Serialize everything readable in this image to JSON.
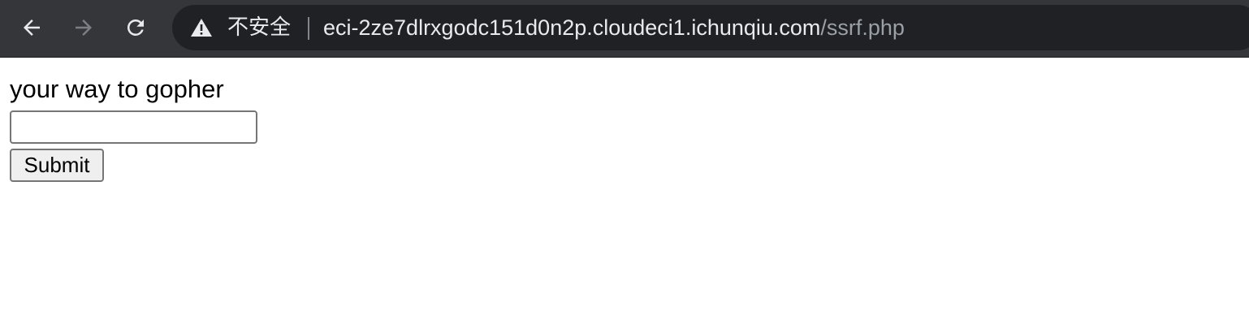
{
  "browser": {
    "nav": {
      "back_icon": "arrow-left-icon",
      "forward_icon": "arrow-right-icon",
      "reload_icon": "reload-icon"
    },
    "omnibox": {
      "warning_icon": "warning-triangle-icon",
      "security_label": "不安全",
      "url_host": "eci-2ze7dlrxgodc151d0n2p.cloudeci1.ichunqiu.com",
      "url_path": "/ssrf.php"
    },
    "colors": {
      "toolbar": "#35363a",
      "omnibox": "#202124",
      "text": "#e8eaed",
      "muted": "#9aa0a6"
    }
  },
  "page": {
    "prompt_text": "your way to gopher",
    "input_value": "",
    "submit_label": "Submit"
  }
}
